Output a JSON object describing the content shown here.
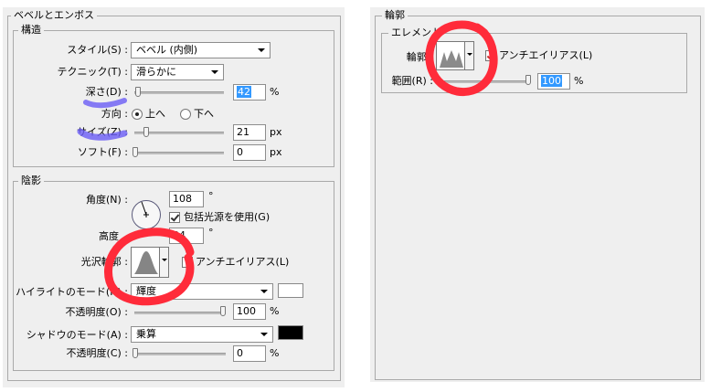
{
  "left_panel": {
    "bevel_group_title": "ベベルとエンボス",
    "structure": {
      "title": "構造",
      "style_label": "スタイル(S) :",
      "style_value": "ベベル (内側)",
      "technique_label": "テクニック(T) :",
      "technique_value": "滑らかに",
      "depth_label": "深さ(D) :",
      "depth_value": "42",
      "depth_unit": "%",
      "direction_label": "方向 :",
      "direction_up": "上へ",
      "direction_down": "下へ",
      "size_label": "サイズ(Z) :",
      "size_value": "21",
      "size_unit": "px",
      "soften_label": "ソフト(F) :",
      "soften_value": "0",
      "soften_unit": "px"
    },
    "shading": {
      "title": "陰影",
      "angle_label": "角度(N) :",
      "angle_value": "108",
      "angle_unit": "°",
      "global_light_label": "包括光源を使用(G)",
      "altitude_label": "高度",
      "altitude_value": "34",
      "altitude_unit": "°",
      "gloss_contour_label": "光沢輪郭 :",
      "antialias_label": "アンチエイリアス(L)",
      "highlight_mode_label": "ハイライトのモード(H) :",
      "highlight_mode_value": "輝度",
      "highlight_color": "#ffffff",
      "highlight_opacity_label": "不透明度(O) :",
      "highlight_opacity_value": "100",
      "highlight_opacity_unit": "%",
      "shadow_mode_label": "シャドウのモード(A) :",
      "shadow_mode_value": "乗算",
      "shadow_color": "#000000",
      "shadow_opacity_label": "不透明度(C) :",
      "shadow_opacity_value": "0",
      "shadow_opacity_unit": "%"
    }
  },
  "right_panel": {
    "group_title": "輪郭",
    "elements_title": "エレメント",
    "contour_label": "輪郭 :",
    "antialias_label": "アンチエイリアス(L)",
    "range_label": "範囲(R) :",
    "range_value": "100",
    "range_unit": "%"
  },
  "colors": {
    "panel_bg": "#efefef",
    "annotation_red": "#ff2b3a",
    "annotation_blue": "#6a5cf5"
  }
}
